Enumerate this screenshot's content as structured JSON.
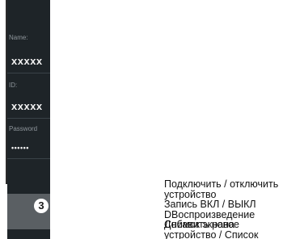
{
  "form": {
    "name_label": "Name:",
    "name_value": "xxxxx",
    "id_label": "ID:",
    "id_value": "xxxxx",
    "password_label": "Password",
    "password_value": "••••••"
  },
  "badge": {
    "number": "3"
  },
  "legend": {
    "line1": "Подключить / отключить",
    "line2": "устройство",
    "line3": "Запись ВКЛ / ВЫКЛ",
    "line4": "DВоспроизведение",
    "line5a": "Снимок экрана",
    "line5b": "Добавить новое",
    "line6": "устройство / Список"
  },
  "colors": {
    "panel": "#1e2428",
    "label": "#8e959b",
    "value": "#f2f2f2",
    "badge_strip": "#5a5f63"
  }
}
